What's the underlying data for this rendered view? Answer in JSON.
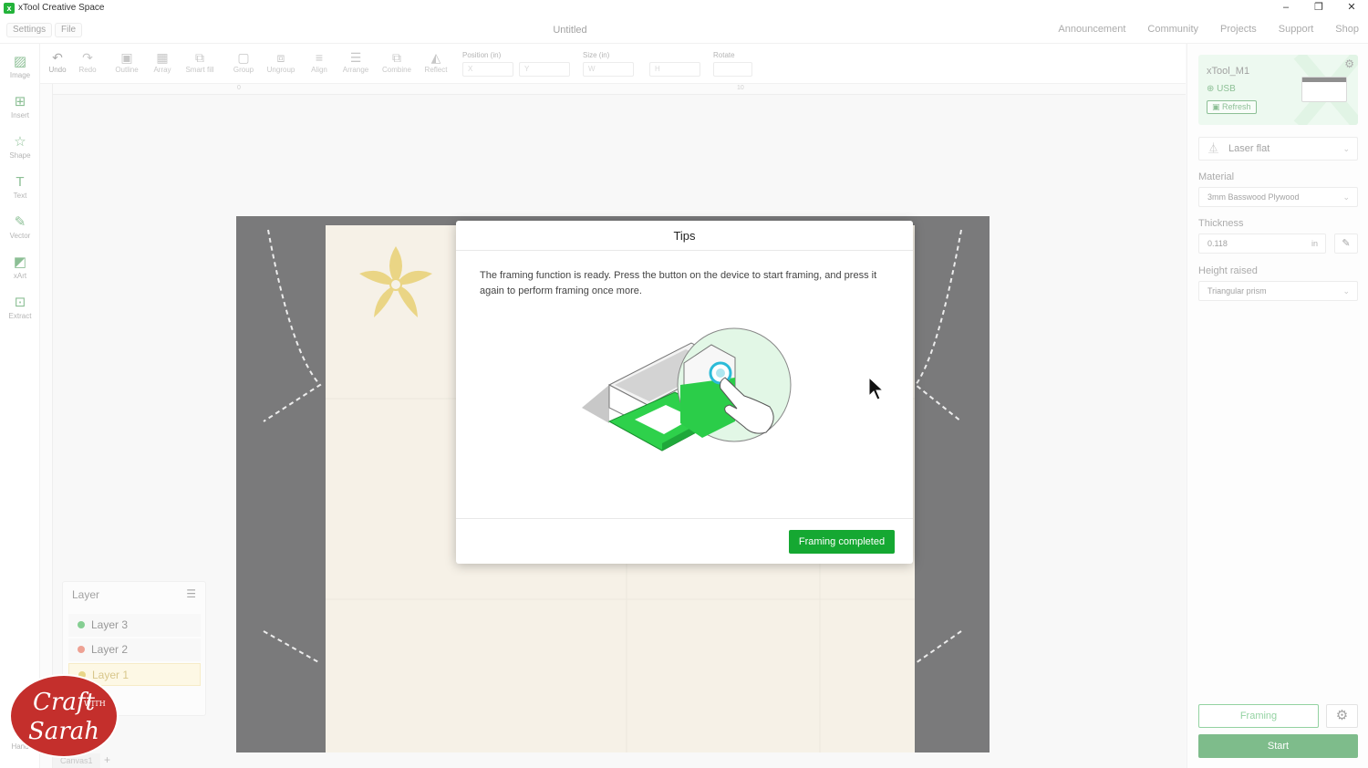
{
  "app": {
    "title": "xTool Creative Space"
  },
  "window": {
    "minimize": "–",
    "restore": "❐",
    "close": "✕"
  },
  "menubar": {
    "settings": "Settings",
    "file": "File",
    "doc_title": "Untitled",
    "links": [
      "Announcement",
      "Community",
      "Projects",
      "Support",
      "Shop"
    ]
  },
  "toolbar": {
    "tools": [
      {
        "label": "Undo",
        "icon": "undo-icon",
        "glyph": "↶"
      },
      {
        "label": "Redo",
        "icon": "redo-icon",
        "glyph": "↷"
      },
      {
        "label": "Outline",
        "icon": "outline-icon",
        "glyph": "▣"
      },
      {
        "label": "Array",
        "icon": "array-icon",
        "glyph": "▦"
      },
      {
        "label": "Smart fill",
        "icon": "smart-fill-icon",
        "glyph": "⧉"
      },
      {
        "label": "Group",
        "icon": "group-icon",
        "glyph": "▢"
      },
      {
        "label": "Ungroup",
        "icon": "ungroup-icon",
        "glyph": "⧈"
      },
      {
        "label": "Align",
        "icon": "align-icon",
        "glyph": "≡"
      },
      {
        "label": "Arrange",
        "icon": "arrange-icon",
        "glyph": "☰"
      },
      {
        "label": "Combine",
        "icon": "combine-icon",
        "glyph": "⧉"
      },
      {
        "label": "Reflect",
        "icon": "reflect-icon",
        "glyph": "◭"
      }
    ],
    "position_label": "Position (in)",
    "x_placeholder": "X",
    "y_placeholder": "Y",
    "size_label": "Size (in)",
    "w_placeholder": "W",
    "h_placeholder": "H",
    "rotate_label": "Rotate",
    "rotate_value": "",
    "ruler_marks": [
      "0",
      "10"
    ]
  },
  "sidebar": {
    "items": [
      {
        "label": "Image",
        "icon": "image-icon",
        "glyph": "▨"
      },
      {
        "label": "Insert",
        "icon": "insert-icon",
        "glyph": "⊞"
      },
      {
        "label": "Shape",
        "icon": "shape-icon",
        "glyph": "☆"
      },
      {
        "label": "Text",
        "icon": "text-icon",
        "glyph": "T"
      },
      {
        "label": "Vector",
        "icon": "vector-icon",
        "glyph": "✎"
      },
      {
        "label": "xArt",
        "icon": "xart-icon",
        "glyph": "◩"
      },
      {
        "label": "Extract",
        "icon": "extract-icon",
        "glyph": "⊡"
      }
    ],
    "hand_label": "Hand"
  },
  "device": {
    "name": "xTool_M1",
    "connection": "USB",
    "refresh": "Refresh"
  },
  "settings_panel": {
    "mode": "Laser flat",
    "material_label": "Material",
    "material": "3mm Basswood Plywood",
    "thickness_label": "Thickness",
    "thickness": "0.118",
    "thickness_unit": "in",
    "height_label": "Height raised",
    "height": "Triangular prism",
    "framing": "Framing",
    "start": "Start"
  },
  "layers": {
    "title": "Layer",
    "items": [
      {
        "label": "Layer 3",
        "color": "#22a63a"
      },
      {
        "label": "Layer 2",
        "color": "#e0553b"
      },
      {
        "label": "Layer 1",
        "color": "#d8b527"
      }
    ]
  },
  "canvas_tab": "Canvas1",
  "watermark": {
    "line1": "Craft",
    "with": "WITH",
    "line2": "Sarah"
  },
  "dialog": {
    "title": "Tips",
    "message": "The framing function is ready. Press the button on the device to start framing, and press it again to perform framing once more.",
    "button": "Framing completed"
  },
  "colors": {
    "accent": "#15a832",
    "start": "#15862c",
    "device_card": "#dff5e3"
  }
}
